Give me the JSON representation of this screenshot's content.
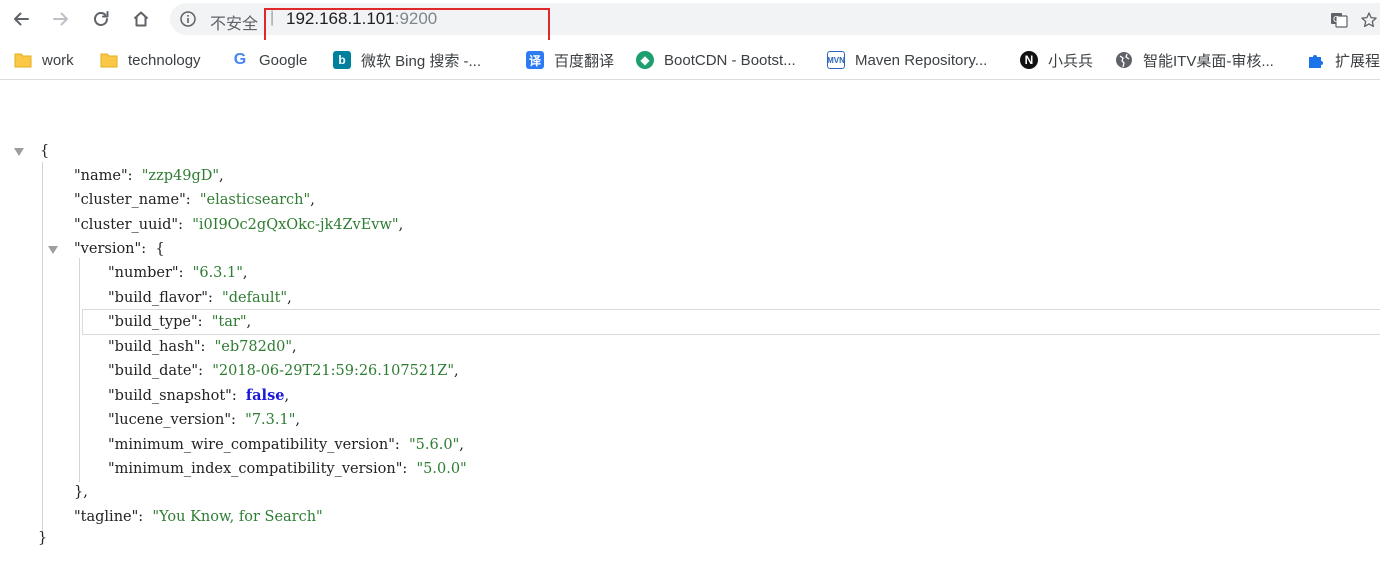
{
  "address_bar": {
    "security_label": "不安全",
    "separator": "|",
    "host": "192.168.1.101",
    "port": ":9200"
  },
  "bookmarks": [
    {
      "label": "work",
      "icon": "folder-icon"
    },
    {
      "label": "technology",
      "icon": "folder-icon"
    },
    {
      "label": "Google",
      "icon": "google-icon"
    },
    {
      "label": "微软 Bing 搜索 -...",
      "icon": "bing-icon"
    },
    {
      "label": "百度翻译",
      "icon": "baidu-translate-icon"
    },
    {
      "label": "BootCDN - Bootst...",
      "icon": "bootcdn-icon"
    },
    {
      "label": "Maven Repository...",
      "icon": "maven-icon"
    },
    {
      "label": "小兵兵",
      "icon": "notion-icon"
    },
    {
      "label": "智能ITV桌面-审核...",
      "icon": "globe-icon"
    },
    {
      "label": "扩展程",
      "icon": "extension-puzzle-icon"
    }
  ],
  "json": {
    "open_brace": "{",
    "close_brace": "}",
    "name_key": "\"name\"",
    "name_val": "\"zzp49gD\"",
    "cluster_name_key": "\"cluster_name\"",
    "cluster_name_val": "\"elasticsearch\"",
    "cluster_uuid_key": "\"cluster_uuid\"",
    "cluster_uuid_val": "\"i0I9Oc2gQxOkc-jk4ZvEvw\"",
    "version_key": "\"version\"",
    "version_open": "{",
    "version_close": "},",
    "number_key": "\"number\"",
    "number_val": "\"6.3.1\"",
    "build_flavor_key": "\"build_flavor\"",
    "build_flavor_val": "\"default\"",
    "build_type_key": "\"build_type\"",
    "build_type_val": "\"tar\"",
    "build_hash_key": "\"build_hash\"",
    "build_hash_val": "\"eb782d0\"",
    "build_date_key": "\"build_date\"",
    "build_date_val": "\"2018-06-29T21:59:26.107521Z\"",
    "build_snapshot_key": "\"build_snapshot\"",
    "build_snapshot_val": "false",
    "lucene_version_key": "\"lucene_version\"",
    "lucene_version_val": "\"7.3.1\"",
    "min_wire_key": "\"minimum_wire_compatibility_version\"",
    "min_wire_val": "\"5.6.0\"",
    "min_index_key": "\"minimum_index_compatibility_version\"",
    "min_index_val": "\"5.0.0\"",
    "tagline_key": "\"tagline\"",
    "tagline_val": "\"You Know, for Search\""
  }
}
